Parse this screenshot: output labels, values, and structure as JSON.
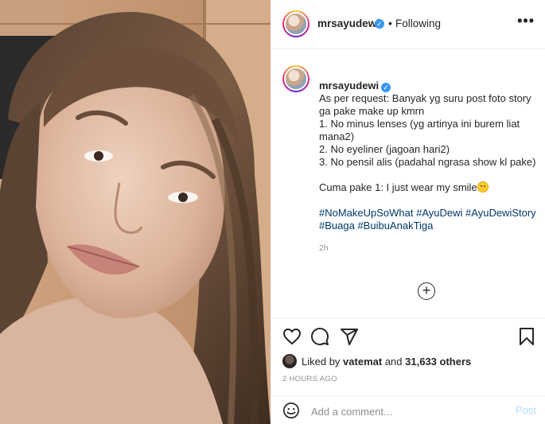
{
  "header": {
    "username": "mrsayudewi",
    "separator": "•",
    "follow_status": "Following",
    "more_icon": "more-horizontal-icon"
  },
  "caption": {
    "username": "mrsayudewi",
    "lines": [
      "As per request: Banyak yg suru post foto story ga pake make up kmrn",
      "1. No minus lenses (yg artinya ini burem liat mana2)",
      "2. No eyeliner (jagoan hari2)",
      "3. No pensil alis (padahal ngrasa show kl pake)"
    ],
    "closing": "Cuma pake 1: I just wear my smile",
    "hashtags": [
      "#NoMakeUpSoWhat",
      "#AyuDewi",
      "#AyuDewiStory",
      "#Buaga",
      "#BuibuAnakTiga"
    ],
    "time": "2h"
  },
  "load_more": {
    "icon": "plus-circle-icon",
    "label": "+"
  },
  "actions": {
    "like_icon": "heart-icon",
    "comment_icon": "comment-icon",
    "share_icon": "send-icon",
    "save_icon": "bookmark-icon"
  },
  "likes": {
    "prefix": "Liked by",
    "user": "vatemat",
    "middle": "and",
    "count": "31,633 others"
  },
  "timestamp": "2 HOURS AGO",
  "comment_box": {
    "placeholder": "Add a comment...",
    "post_label": "Post"
  },
  "colors": {
    "verified": "#3897f0",
    "hashtag": "#00376b",
    "muted": "#8e8e8e",
    "post_disabled": "#b2dffc"
  }
}
